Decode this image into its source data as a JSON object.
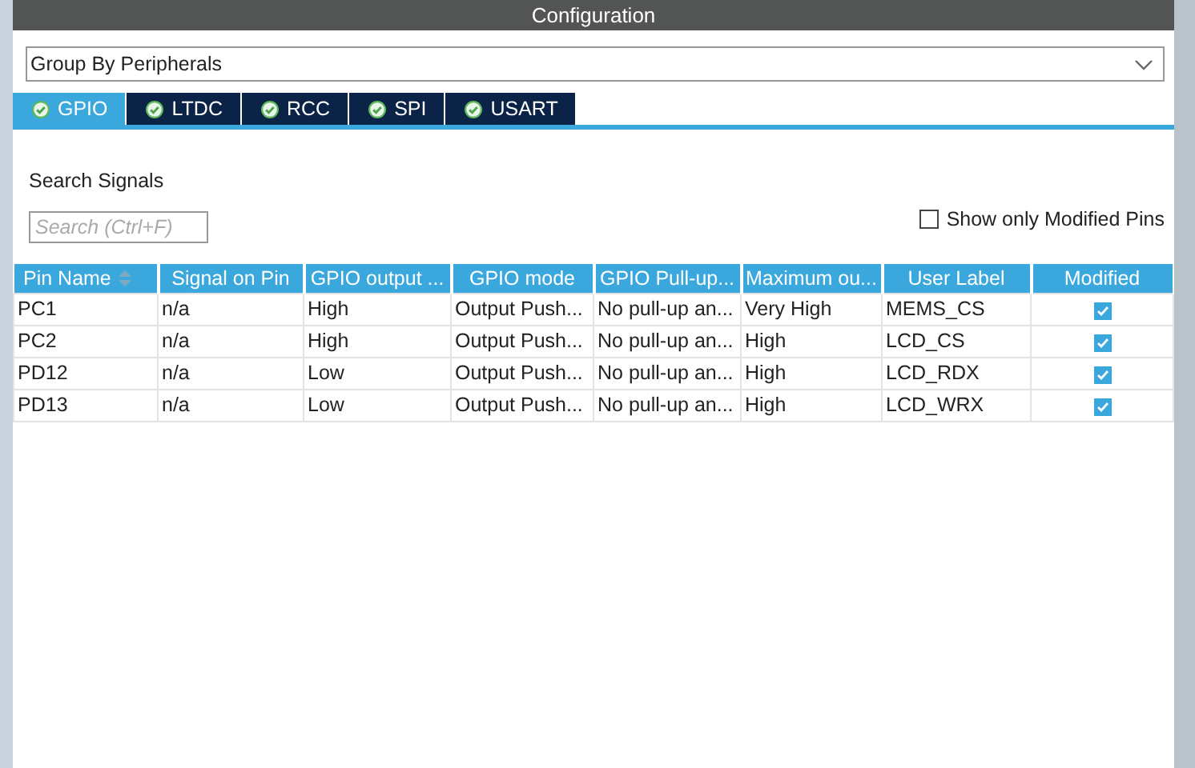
{
  "window": {
    "title": "Configuration"
  },
  "group_select": {
    "value": "Group By Peripherals"
  },
  "tabs": [
    {
      "label": "GPIO",
      "selected": true
    },
    {
      "label": "LTDC",
      "selected": false
    },
    {
      "label": "RCC",
      "selected": false
    },
    {
      "label": "SPI",
      "selected": false
    },
    {
      "label": "USART",
      "selected": false
    }
  ],
  "search": {
    "label": "Search Signals",
    "placeholder": "Search (Ctrl+F)"
  },
  "show_modified": {
    "label": "Show only Modified Pins",
    "checked": false
  },
  "table": {
    "columns": [
      "Pin Name",
      "Signal on Pin",
      "GPIO output ...",
      "GPIO mode",
      "GPIO Pull-up...",
      "Maximum ou...",
      "User Label",
      "Modified"
    ],
    "rows": [
      {
        "cells": [
          "PC1",
          "n/a",
          "High",
          "Output Push...",
          "No pull-up an...",
          "Very High",
          "MEMS_CS"
        ],
        "modified": true
      },
      {
        "cells": [
          "PC2",
          "n/a",
          "High",
          "Output Push...",
          "No pull-up an...",
          "High",
          "LCD_CS"
        ],
        "modified": true
      },
      {
        "cells": [
          "PD12",
          "n/a",
          "Low",
          "Output Push...",
          "No pull-up an...",
          "High",
          "LCD_RDX"
        ],
        "modified": true
      },
      {
        "cells": [
          "PD13",
          "n/a",
          "Low",
          "Output Push...",
          "No pull-up an...",
          "High",
          "LCD_WRX"
        ],
        "modified": true
      }
    ]
  }
}
